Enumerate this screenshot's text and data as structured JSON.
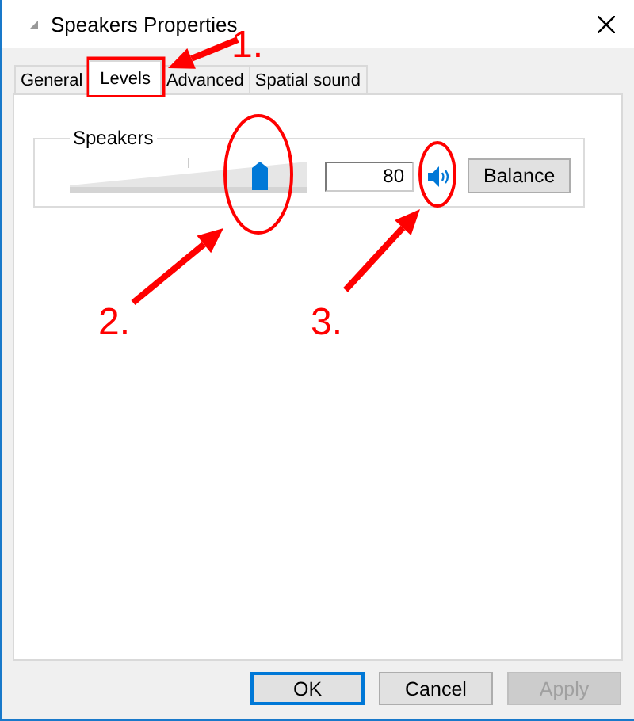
{
  "window": {
    "title": "Speakers Properties"
  },
  "tabs": [
    {
      "label": "General",
      "selected": false
    },
    {
      "label": "Levels",
      "selected": true
    },
    {
      "label": "Advanced",
      "selected": false
    },
    {
      "label": "Spatial sound",
      "selected": false
    }
  ],
  "levels": {
    "group_label": "Speakers",
    "level": 0.8,
    "value": "80",
    "muted": false,
    "balance_button": "Balance"
  },
  "buttons": [
    {
      "label": "OK",
      "default": true,
      "disabled": false
    },
    {
      "label": "Cancel",
      "default": false,
      "disabled": false
    },
    {
      "label": "Apply",
      "default": false,
      "disabled": true
    }
  ],
  "annotations": [
    {
      "number": "1."
    },
    {
      "number": "2."
    },
    {
      "number": "3."
    }
  ]
}
